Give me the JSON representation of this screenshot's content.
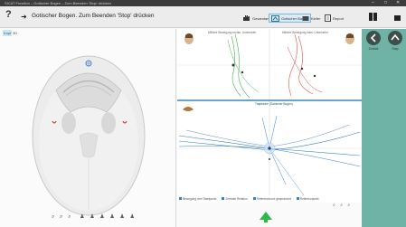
{
  "window": {
    "title": "SICAT Function – Gotischer Bogen – Zum Beenden 'Stop' drücken",
    "controls": [
      "–",
      "□",
      "✕"
    ]
  },
  "toolbar": {
    "help_label": "?",
    "instruction": "Gotischer Bogen. Zum Beenden 'Stop' drücken",
    "buttons": [
      {
        "label": "Gesamtansicht",
        "active": false,
        "icon": "hand-icon"
      },
      {
        "label": "Gotischer Bogen",
        "active": true,
        "icon": "arch-icon"
      },
      {
        "label": "Kiefer",
        "active": false,
        "icon": "jaw-icon"
      },
      {
        "label": "Report",
        "active": false,
        "icon": "report-icon"
      }
    ]
  },
  "left_panel": {
    "tabs": [
      "Kopf",
      "3D"
    ],
    "bottom_controls": [
      "⌕",
      "⌕",
      "⌕",
      "♟",
      "♟",
      "♟",
      "♟",
      "♟",
      "♟"
    ]
  },
  "top_plot": {
    "left_title": "Mittlere Bewegung rechts: Unterkiefer",
    "right_title": "Mittlere Bewegung links: Unterkiefer"
  },
  "bottom_plot": {
    "title": "Trajektorie (Gotischer Bogen)",
    "legend": [
      "Bewegung vom Startpunkt",
      "Zentrale Relation",
      "Referenzkurve gespeichert",
      "Referenzpunkt"
    ],
    "zoom_controls": [
      "⌕",
      "⌕",
      "⌕"
    ]
  },
  "right_panel": {
    "buttons": [
      {
        "label": "Zurück",
        "icon": "back-icon"
      },
      {
        "label": "Stop",
        "icon": "stop-icon"
      }
    ]
  },
  "colors": {
    "accent": "#6fb2a6",
    "active_tab": "#cfe7f5",
    "trace_blue": "#3a7fc0",
    "trace_green": "#4caf50",
    "trace_red": "#e05050",
    "arrow_green": "#2db84a"
  }
}
